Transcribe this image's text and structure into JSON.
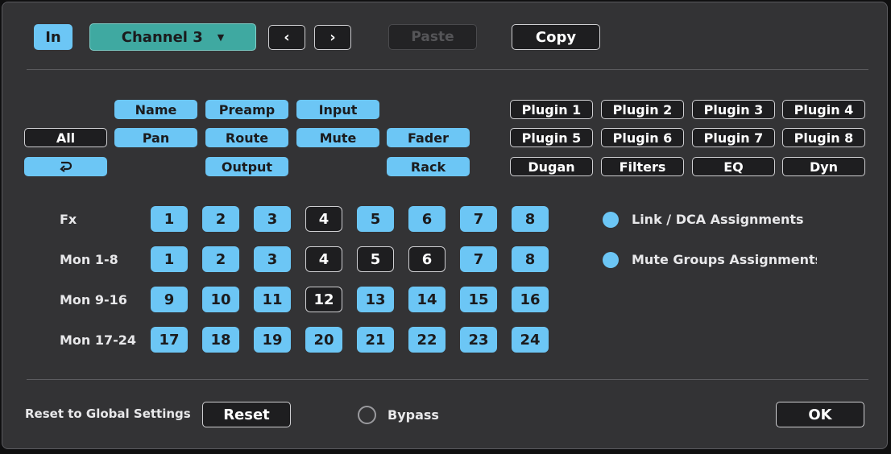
{
  "header": {
    "in_label": "In",
    "channel_label": "Channel 3",
    "prev_label": "‹",
    "next_label": "›",
    "paste_label": "Paste",
    "copy_label": "Copy"
  },
  "filters": {
    "all": "All",
    "name": "Name",
    "preamp": "Preamp",
    "input": "Input",
    "pan": "Pan",
    "route": "Route",
    "mute": "Mute",
    "fader": "Fader",
    "output": "Output",
    "rack": "Rack",
    "plugins": [
      "Plugin 1",
      "Plugin 2",
      "Plugin 3",
      "Plugin 4",
      "Plugin 5",
      "Plugin 6",
      "Plugin 7",
      "Plugin 8"
    ],
    "processors": [
      "Dugan",
      "Filters",
      "EQ",
      "Dyn"
    ]
  },
  "grid": {
    "rows": [
      {
        "label": "Fx",
        "cells": [
          {
            "n": "1",
            "on": true
          },
          {
            "n": "2",
            "on": true
          },
          {
            "n": "3",
            "on": true
          },
          {
            "n": "4",
            "on": false
          },
          {
            "n": "5",
            "on": true
          },
          {
            "n": "6",
            "on": true
          },
          {
            "n": "7",
            "on": true
          },
          {
            "n": "8",
            "on": true
          }
        ]
      },
      {
        "label": "Mon 1-8",
        "cells": [
          {
            "n": "1",
            "on": true
          },
          {
            "n": "2",
            "on": true
          },
          {
            "n": "3",
            "on": true
          },
          {
            "n": "4",
            "on": false
          },
          {
            "n": "5",
            "on": false
          },
          {
            "n": "6",
            "on": false
          },
          {
            "n": "7",
            "on": true
          },
          {
            "n": "8",
            "on": true
          }
        ]
      },
      {
        "label": "Mon 9-16",
        "cells": [
          {
            "n": "9",
            "on": true
          },
          {
            "n": "10",
            "on": true
          },
          {
            "n": "11",
            "on": true
          },
          {
            "n": "12",
            "on": false
          },
          {
            "n": "13",
            "on": true
          },
          {
            "n": "14",
            "on": true
          },
          {
            "n": "15",
            "on": true
          },
          {
            "n": "16",
            "on": true
          }
        ]
      },
      {
        "label": "Mon 17-24",
        "cells": [
          {
            "n": "17",
            "on": true
          },
          {
            "n": "18",
            "on": true
          },
          {
            "n": "19",
            "on": true
          },
          {
            "n": "20",
            "on": true
          },
          {
            "n": "21",
            "on": true
          },
          {
            "n": "22",
            "on": true
          },
          {
            "n": "23",
            "on": true
          },
          {
            "n": "24",
            "on": true
          }
        ]
      }
    ]
  },
  "assignments": {
    "link_dca": "Link / DCA Assignments",
    "mute_groups": "Mute Groups Assignments"
  },
  "footer": {
    "reset_text": "Reset to Global Settings",
    "reset_label": "Reset",
    "bypass_label": "Bypass",
    "ok_label": "OK"
  },
  "colors": {
    "accent": "#6cc6f5",
    "teal": "#3fa9a1",
    "dialog_bg": "#333335",
    "button_dark": "#1e1e20"
  },
  "icons": {
    "recall": "undo-arrow-icon"
  }
}
